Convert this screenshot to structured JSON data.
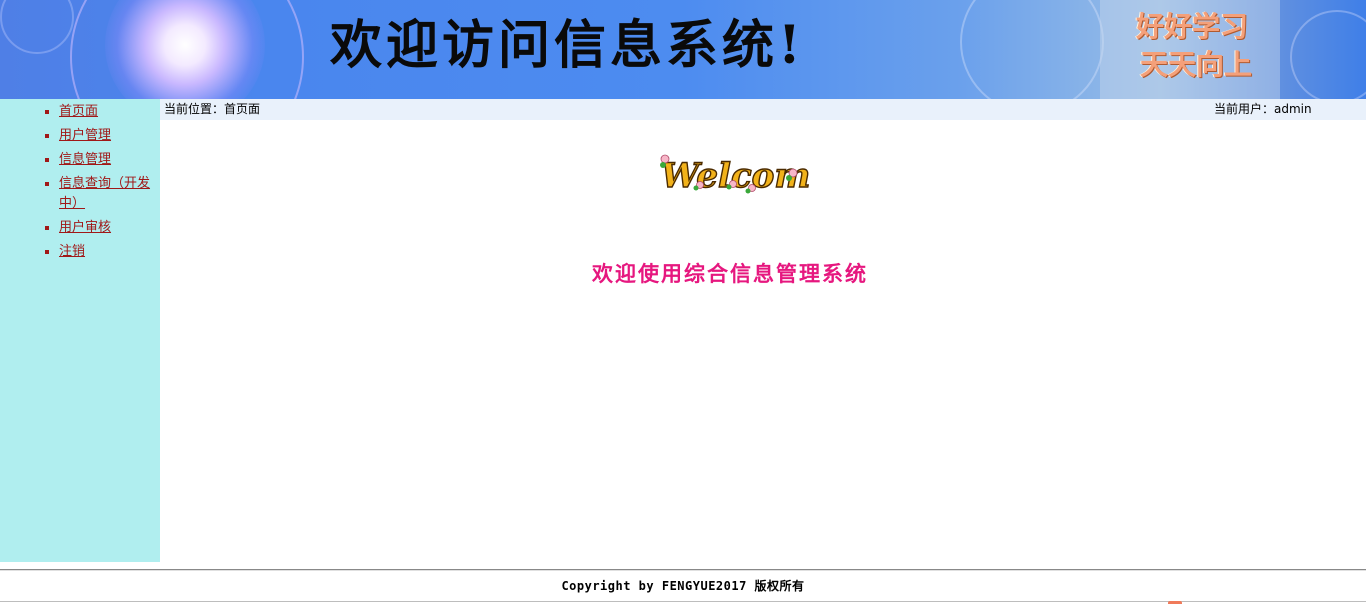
{
  "banner": {
    "title": "欢迎访问信息系统!",
    "motto_line1": "好好学习",
    "motto_line2": "天天向上"
  },
  "sidebar": {
    "items": [
      {
        "label": "首页面"
      },
      {
        "label": "用户管理"
      },
      {
        "label": "信息管理"
      },
      {
        "label": "信息查询（开发中）"
      },
      {
        "label": "用户审核"
      },
      {
        "label": "注销"
      }
    ]
  },
  "location_bar": {
    "location": "当前位置：首页面",
    "current_user": "当前用户：admin"
  },
  "main": {
    "welcome_image_text": "Welcome",
    "heading": "欢迎使用综合信息管理系统"
  },
  "footer": {
    "copyright": "Copyright by FENGYUE2017 版权所有"
  },
  "colors": {
    "sidebar_bg": "#b0eeef",
    "link": "#a01818",
    "heading": "#e6177f",
    "location_bar_bg": "#e9f1fb"
  }
}
